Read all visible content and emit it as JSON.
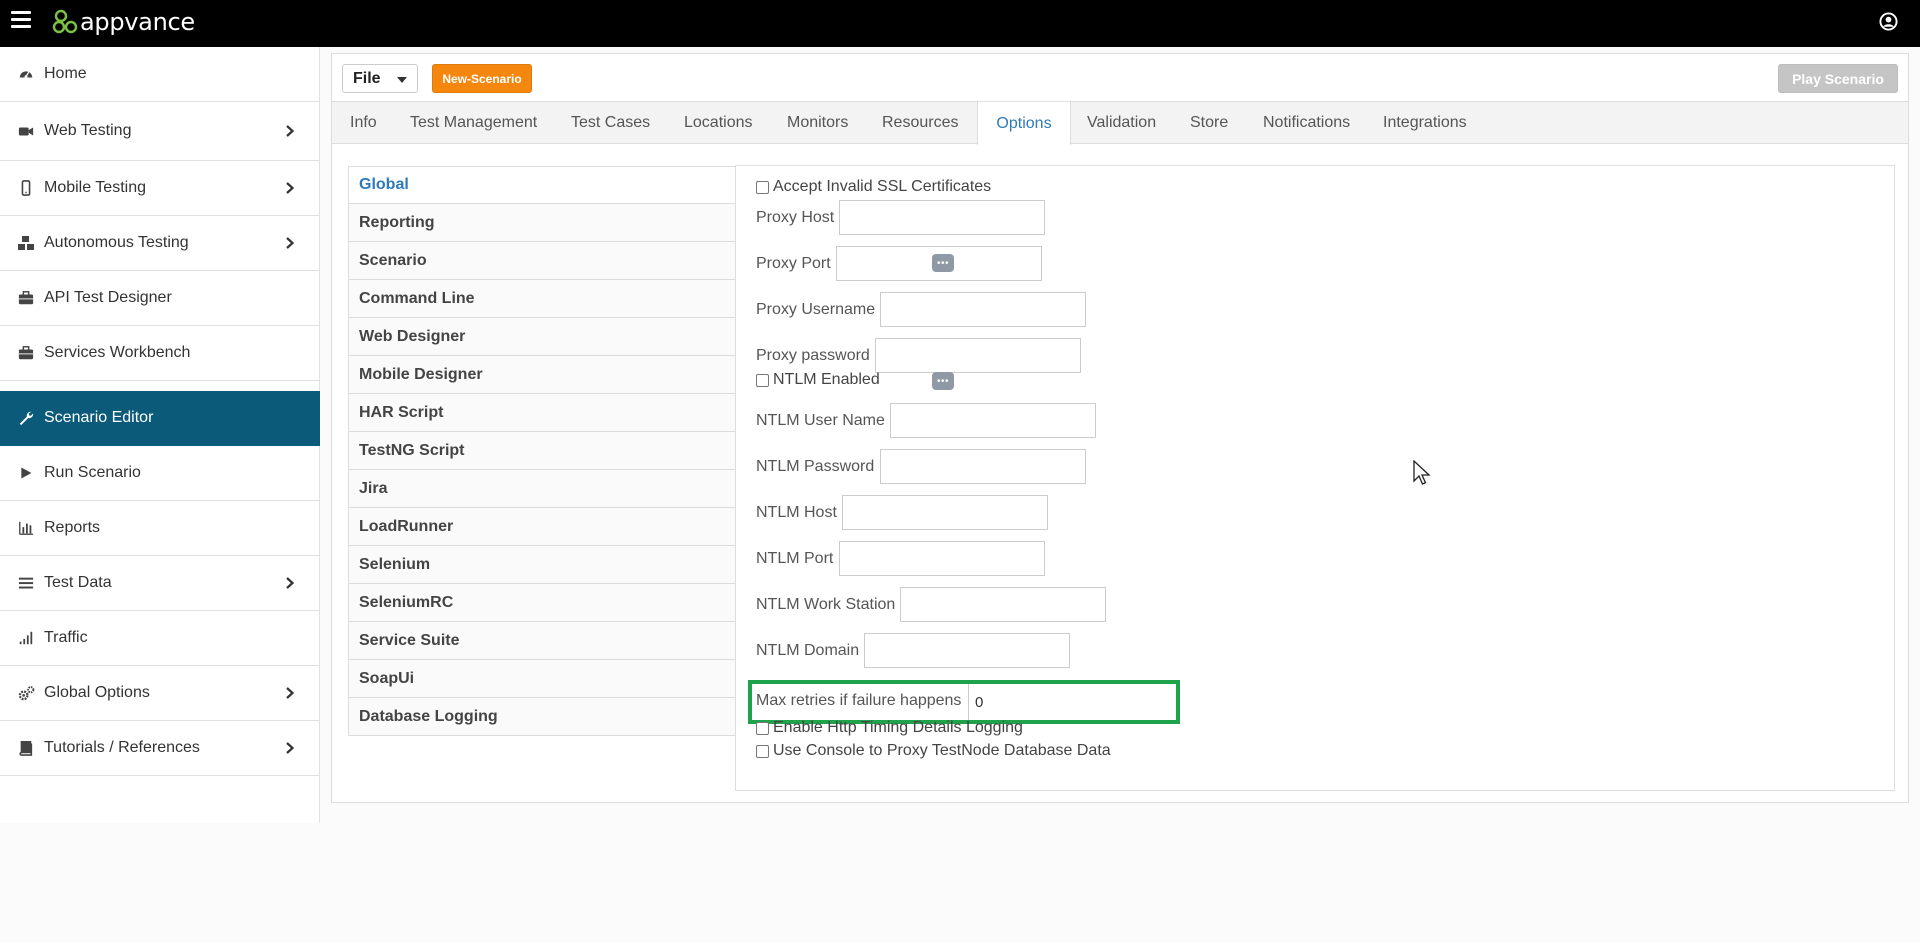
{
  "header": {
    "logo_text": "appvance",
    "menu_icon": "hamburger-menu-icon",
    "user_icon": "user-account-icon"
  },
  "sidebar": {
    "items": [
      {
        "label": "Home",
        "icon": "dashboard-icon",
        "has_submenu": false,
        "active": false
      },
      {
        "label": "Web Testing",
        "icon": "video-camera-icon",
        "has_submenu": true,
        "active": false
      },
      {
        "label": "Mobile Testing",
        "icon": "mobile-phone-icon",
        "has_submenu": true,
        "active": false
      },
      {
        "label": "Autonomous Testing",
        "icon": "cubes-icon",
        "has_submenu": true,
        "active": false
      },
      {
        "label": "API Test Designer",
        "icon": "briefcase-icon",
        "has_submenu": false,
        "active": false
      },
      {
        "label": "Services Workbench",
        "icon": "briefcase-icon",
        "has_submenu": false,
        "active": false
      },
      {
        "label": "Scenario Editor",
        "icon": "wrench-icon",
        "has_submenu": false,
        "active": true
      },
      {
        "label": "Run Scenario",
        "icon": "play-icon",
        "has_submenu": false,
        "active": false
      },
      {
        "label": "Reports",
        "icon": "bar-chart-icon",
        "has_submenu": false,
        "active": false
      },
      {
        "label": "Test Data",
        "icon": "list-icon",
        "has_submenu": true,
        "active": false
      },
      {
        "label": "Traffic",
        "icon": "signal-icon",
        "has_submenu": false,
        "active": false
      },
      {
        "label": "Global Options",
        "icon": "cogs-icon",
        "has_submenu": true,
        "active": false
      },
      {
        "label": "Tutorials / References",
        "icon": "book-icon",
        "has_submenu": true,
        "active": false
      }
    ]
  },
  "toolbar": {
    "file_label": "File",
    "new_scenario_label": "New-Scenario",
    "play_scenario_label": "Play Scenario"
  },
  "tabs": [
    {
      "label": "Info",
      "active": false
    },
    {
      "label": "Test Management",
      "active": false
    },
    {
      "label": "Test Cases",
      "active": false
    },
    {
      "label": "Locations",
      "active": false
    },
    {
      "label": "Monitors",
      "active": false
    },
    {
      "label": "Resources",
      "active": false
    },
    {
      "label": "Options",
      "active": true
    },
    {
      "label": "Validation",
      "active": false
    },
    {
      "label": "Store",
      "active": false
    },
    {
      "label": "Notifications",
      "active": false
    },
    {
      "label": "Integrations",
      "active": false
    }
  ],
  "options_list": [
    {
      "label": "Global",
      "active": true
    },
    {
      "label": "Reporting",
      "active": false
    },
    {
      "label": "Scenario",
      "active": false
    },
    {
      "label": "Command Line",
      "active": false
    },
    {
      "label": "Web Designer",
      "active": false
    },
    {
      "label": "Mobile Designer",
      "active": false
    },
    {
      "label": "HAR Script",
      "active": false
    },
    {
      "label": "TestNG Script",
      "active": false
    },
    {
      "label": "Jira",
      "active": false
    },
    {
      "label": "LoadRunner",
      "active": false
    },
    {
      "label": "Selenium",
      "active": false
    },
    {
      "label": "SeleniumRC",
      "active": false
    },
    {
      "label": "Service Suite",
      "active": false
    },
    {
      "label": "SoapUi",
      "active": false
    },
    {
      "label": "Database Logging",
      "active": false
    }
  ],
  "global_options": {
    "accept_invalid_ssl": {
      "label": "Accept Invalid SSL Certificates",
      "checked": false
    },
    "proxy_host": {
      "label": "Proxy Host",
      "value": ""
    },
    "proxy_port": {
      "label": "Proxy Port",
      "value": ""
    },
    "proxy_username": {
      "label": "Proxy Username",
      "value": ""
    },
    "proxy_password": {
      "label": "Proxy password",
      "value": ""
    },
    "ntlm_enabled": {
      "label": "NTLM Enabled",
      "checked": false
    },
    "ntlm_user_name": {
      "label": "NTLM User Name",
      "value": ""
    },
    "ntlm_password": {
      "label": "NTLM Password",
      "value": ""
    },
    "ntlm_host": {
      "label": "NTLM Host",
      "value": ""
    },
    "ntlm_port": {
      "label": "NTLM Port",
      "value": ""
    },
    "ntlm_work_station": {
      "label": "NTLM Work Station",
      "value": ""
    },
    "ntlm_domain": {
      "label": "NTLM Domain",
      "value": ""
    },
    "max_retries": {
      "label": "Max retries if failure happens",
      "value": "0"
    },
    "http_timing_logging": {
      "label": "Enable Http Timing Details Logging",
      "checked": false
    },
    "console_proxy_db": {
      "label": "Use Console to Proxy TestNode Database Data",
      "checked": false
    },
    "password_manager_icon": "password-dots-icon"
  },
  "colors": {
    "active_nav": "#0c5a7a",
    "active_tab_text": "#2f7bb9",
    "new_scenario_button": "#f5870f",
    "play_button_disabled": "#c5c5c5",
    "highlight_border": "#1fa34a"
  }
}
